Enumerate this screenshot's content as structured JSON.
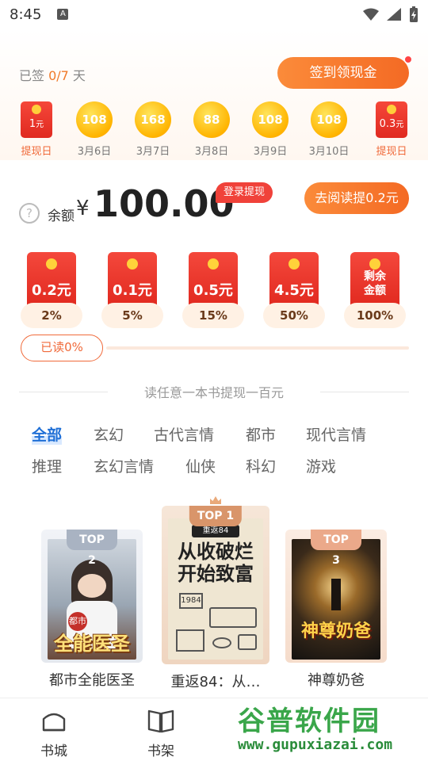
{
  "status_bar": {
    "time": "8:45",
    "notif_letter": "A"
  },
  "sign_in": {
    "signed_prefix": "已签 ",
    "signed_count": "0/7",
    "signed_suffix": " 天",
    "button_label": "签到领现金",
    "days": [
      {
        "type": "cash",
        "amount": "1",
        "unit": "元",
        "label": "提现日"
      },
      {
        "type": "coin",
        "amount": "108",
        "label": "3月6日"
      },
      {
        "type": "coin",
        "amount": "168",
        "label": "3月7日"
      },
      {
        "type": "coin",
        "amount": "88",
        "label": "3月8日"
      },
      {
        "type": "coin",
        "amount": "108",
        "label": "3月9日"
      },
      {
        "type": "coin",
        "amount": "108",
        "label": "3月10日"
      },
      {
        "type": "cash",
        "amount": "0.3",
        "unit": "元",
        "label": "提现日"
      }
    ]
  },
  "balance": {
    "help_glyph": "?",
    "label": "余额",
    "currency": "¥",
    "value": "100.00",
    "login_tag": "登录提现",
    "read_button": "去阅读提0.2元"
  },
  "rewards": [
    {
      "amount": "0.2元",
      "percent": "2%"
    },
    {
      "amount": "0.1元",
      "percent": "5%"
    },
    {
      "amount": "0.5元",
      "percent": "15%"
    },
    {
      "amount": "4.5元",
      "percent": "50%"
    },
    {
      "amount": "剩余金额",
      "percent": "100%"
    }
  ],
  "progress": {
    "label": "已读0%",
    "value": 0
  },
  "section_title": "读任意一本书提现一百元",
  "categories": [
    "全部",
    "玄幻",
    "古代言情",
    "都市",
    "现代言情",
    "推理",
    "玄幻言情",
    "仙侠",
    "科幻",
    "游戏"
  ],
  "active_category": "全部",
  "books": [
    {
      "rank": "TOP 2",
      "title": "都市全能医圣",
      "cover_text": "全能医圣",
      "cover_small": "都市"
    },
    {
      "rank": "TOP 1",
      "title": "重返84：从…",
      "cover_text": "从收破烂开始致富",
      "cover_small": "重返84",
      "cover_tag": "1984"
    },
    {
      "rank": "TOP 3",
      "title": "神尊奶爸",
      "cover_text": "神尊奶爸"
    }
  ],
  "tabs": [
    {
      "label": "书城"
    },
    {
      "label": "书架"
    }
  ],
  "watermark": {
    "main": "谷普软件园",
    "url": "www.gupuxiazai.com"
  },
  "colors": {
    "accent": "#f46a24",
    "red": "#e0281e",
    "active_tab": "#1f6fd6",
    "coin": "#ffb400"
  }
}
